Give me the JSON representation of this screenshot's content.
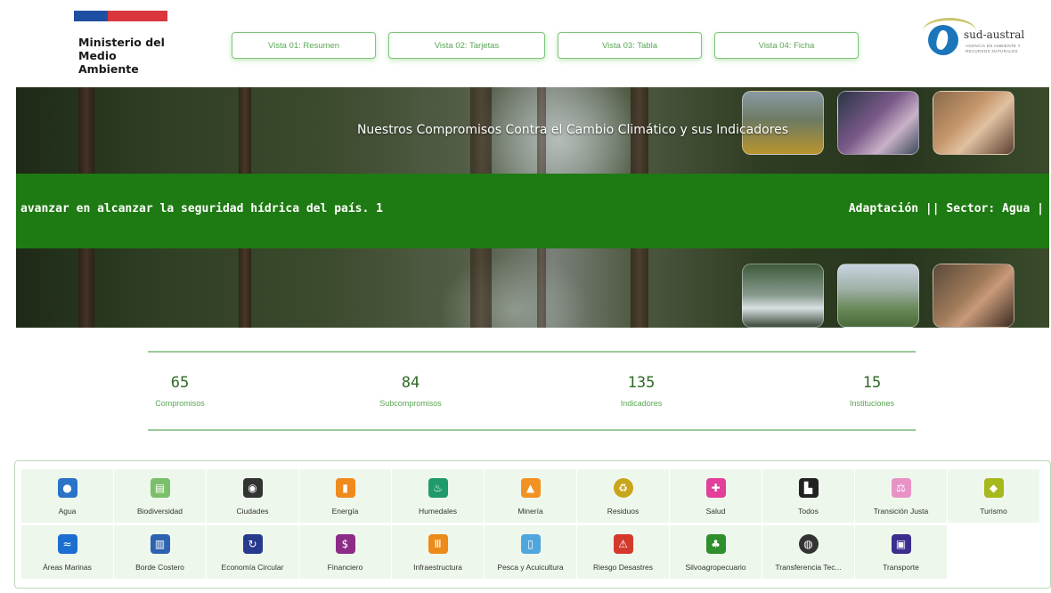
{
  "header": {
    "ministry_lines": [
      "Ministerio del",
      "Medio",
      "Ambiente"
    ],
    "nav": [
      "Vista 01: Resumen",
      "Vista 02: Tarjetas",
      "Vista 03: Tabla",
      "Vista 04: Ficha"
    ],
    "brand": "sud-austral",
    "brand_sub": "AGENCIA EN AMBIENTE Y RECURSOS NATURALES"
  },
  "banner": {
    "title": "Nuestros Compromisos Contra el Cambio Climático y sus Indicadores",
    "ticker_left": "avanzar en alcanzar la seguridad hídrica del país. 1",
    "ticker_right": "Adaptación || Sector: Agua |"
  },
  "stats": [
    {
      "value": "65",
      "label": "Compromisos"
    },
    {
      "value": "84",
      "label": "Subcompromisos"
    },
    {
      "value": "135",
      "label": "Indicadores"
    },
    {
      "value": "15",
      "label": "Instituciones"
    }
  ],
  "sectors": [
    {
      "label": "Agua",
      "icon": "water-drop-icon",
      "color": "#2a73c6"
    },
    {
      "label": "Biodiversidad",
      "icon": "bench-icon",
      "color": "#7bbf6a"
    },
    {
      "label": "Ciudades",
      "icon": "city-pin-icon",
      "color": "#333333"
    },
    {
      "label": "Energía",
      "icon": "energy-icon",
      "color": "#f08a1c"
    },
    {
      "label": "Humedales",
      "icon": "wetland-icon",
      "color": "#1f9a6a"
    },
    {
      "label": "Minería",
      "icon": "mining-icon",
      "color": "#f29222"
    },
    {
      "label": "Residuos",
      "icon": "waste-icon",
      "color": "#c9a51c"
    },
    {
      "label": "Salud",
      "icon": "hospital-icon",
      "color": "#e2409a"
    },
    {
      "label": "Todos",
      "icon": "factory-icon",
      "color": "#222222"
    },
    {
      "label": "Transición Justa",
      "icon": "scale-icon",
      "color": "#e892c6"
    },
    {
      "label": "Turismo",
      "icon": "tourism-icon",
      "color": "#a7b81c"
    },
    {
      "label": "Áreas Marinas",
      "icon": "waves-icon",
      "color": "#1c6fd0"
    },
    {
      "label": "Borde Costero",
      "icon": "coast-icon",
      "color": "#2c62b0"
    },
    {
      "label": "Economía Circular",
      "icon": "recycle-icon",
      "color": "#283a8e"
    },
    {
      "label": "Financiero",
      "icon": "finance-icon",
      "color": "#8c2c87"
    },
    {
      "label": "Infraestructura",
      "icon": "building-icon",
      "color": "#ec8a1a"
    },
    {
      "label": "Pesca y Acuicultura",
      "icon": "fishing-icon",
      "color": "#4fa6dc"
    },
    {
      "label": "Riesgo Desastres",
      "icon": "disaster-icon",
      "color": "#d43a2c"
    },
    {
      "label": "Silvoagropecuario",
      "icon": "tree-icon",
      "color": "#2e8f2b"
    },
    {
      "label": "Transferencia Tec...",
      "icon": "tech-transfer-icon",
      "color": "#333333"
    },
    {
      "label": "Transporte",
      "icon": "bus-icon",
      "color": "#3a2f8e"
    }
  ]
}
